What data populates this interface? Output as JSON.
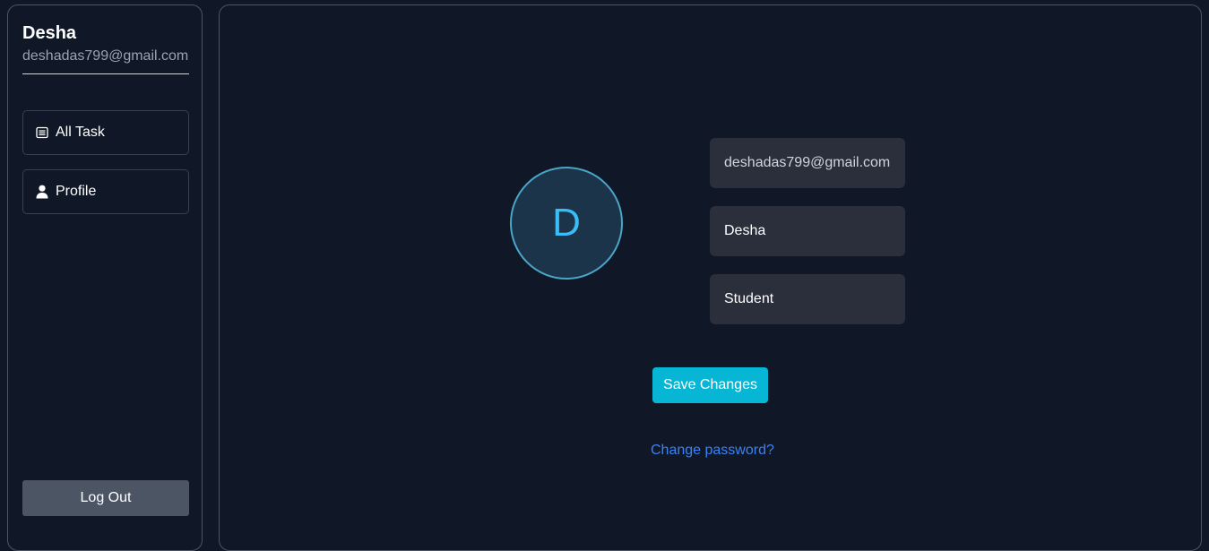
{
  "sidebar": {
    "user": {
      "name": "Desha",
      "email": "deshadas799@gmail.com"
    },
    "nav": {
      "all_task": {
        "label": "All Task",
        "icon": "list-icon"
      },
      "profile": {
        "label": "Profile",
        "icon": "user-icon"
      }
    },
    "logout_label": "Log Out"
  },
  "profile": {
    "avatar_letter": "D",
    "fields": {
      "email": "deshadas799@gmail.com",
      "name": "Desha",
      "role": "Student"
    },
    "save_label": "Save Changes",
    "change_password_label": "Change password?"
  },
  "colors": {
    "background": "#101827",
    "accent": "#06b6d4",
    "link": "#3b82f6",
    "avatar_letter": "#38bdf8",
    "field_background": "#2b2e3b",
    "logout_background": "#4b5563"
  }
}
